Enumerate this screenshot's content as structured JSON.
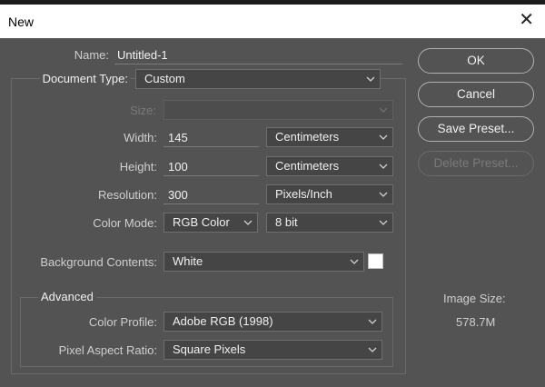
{
  "window": {
    "title": "New",
    "close_glyph": "✕",
    "close_icon": "close-icon"
  },
  "name": {
    "label": "Name:",
    "value": "Untitled-1"
  },
  "document_type": {
    "label": "Document Type:",
    "value": "Custom"
  },
  "size": {
    "label": "Size:",
    "value": ""
  },
  "width": {
    "label": "Width:",
    "value": "145",
    "unit": "Centimeters"
  },
  "height": {
    "label": "Height:",
    "value": "100",
    "unit": "Centimeters"
  },
  "resolution": {
    "label": "Resolution:",
    "value": "300",
    "unit": "Pixels/Inch"
  },
  "color_mode": {
    "label": "Color Mode:",
    "value": "RGB Color",
    "depth": "8 bit"
  },
  "background": {
    "label": "Background Contents:",
    "value": "White",
    "swatch_color": "#ffffff"
  },
  "advanced": {
    "legend": "Advanced",
    "color_profile": {
      "label": "Color Profile:",
      "value": "Adobe RGB (1998)"
    },
    "pixel_aspect": {
      "label": "Pixel Aspect Ratio:",
      "value": "Square Pixels"
    }
  },
  "buttons": {
    "ok": "OK",
    "cancel": "Cancel",
    "save_preset": "Save Preset...",
    "delete_preset": "Delete Preset..."
  },
  "image_size": {
    "label": "Image Size:",
    "value": "578.7M"
  },
  "colors": {
    "dialog_bg": "#535353",
    "field_bg": "#454545",
    "titlebar_bg": "#ffffff"
  }
}
